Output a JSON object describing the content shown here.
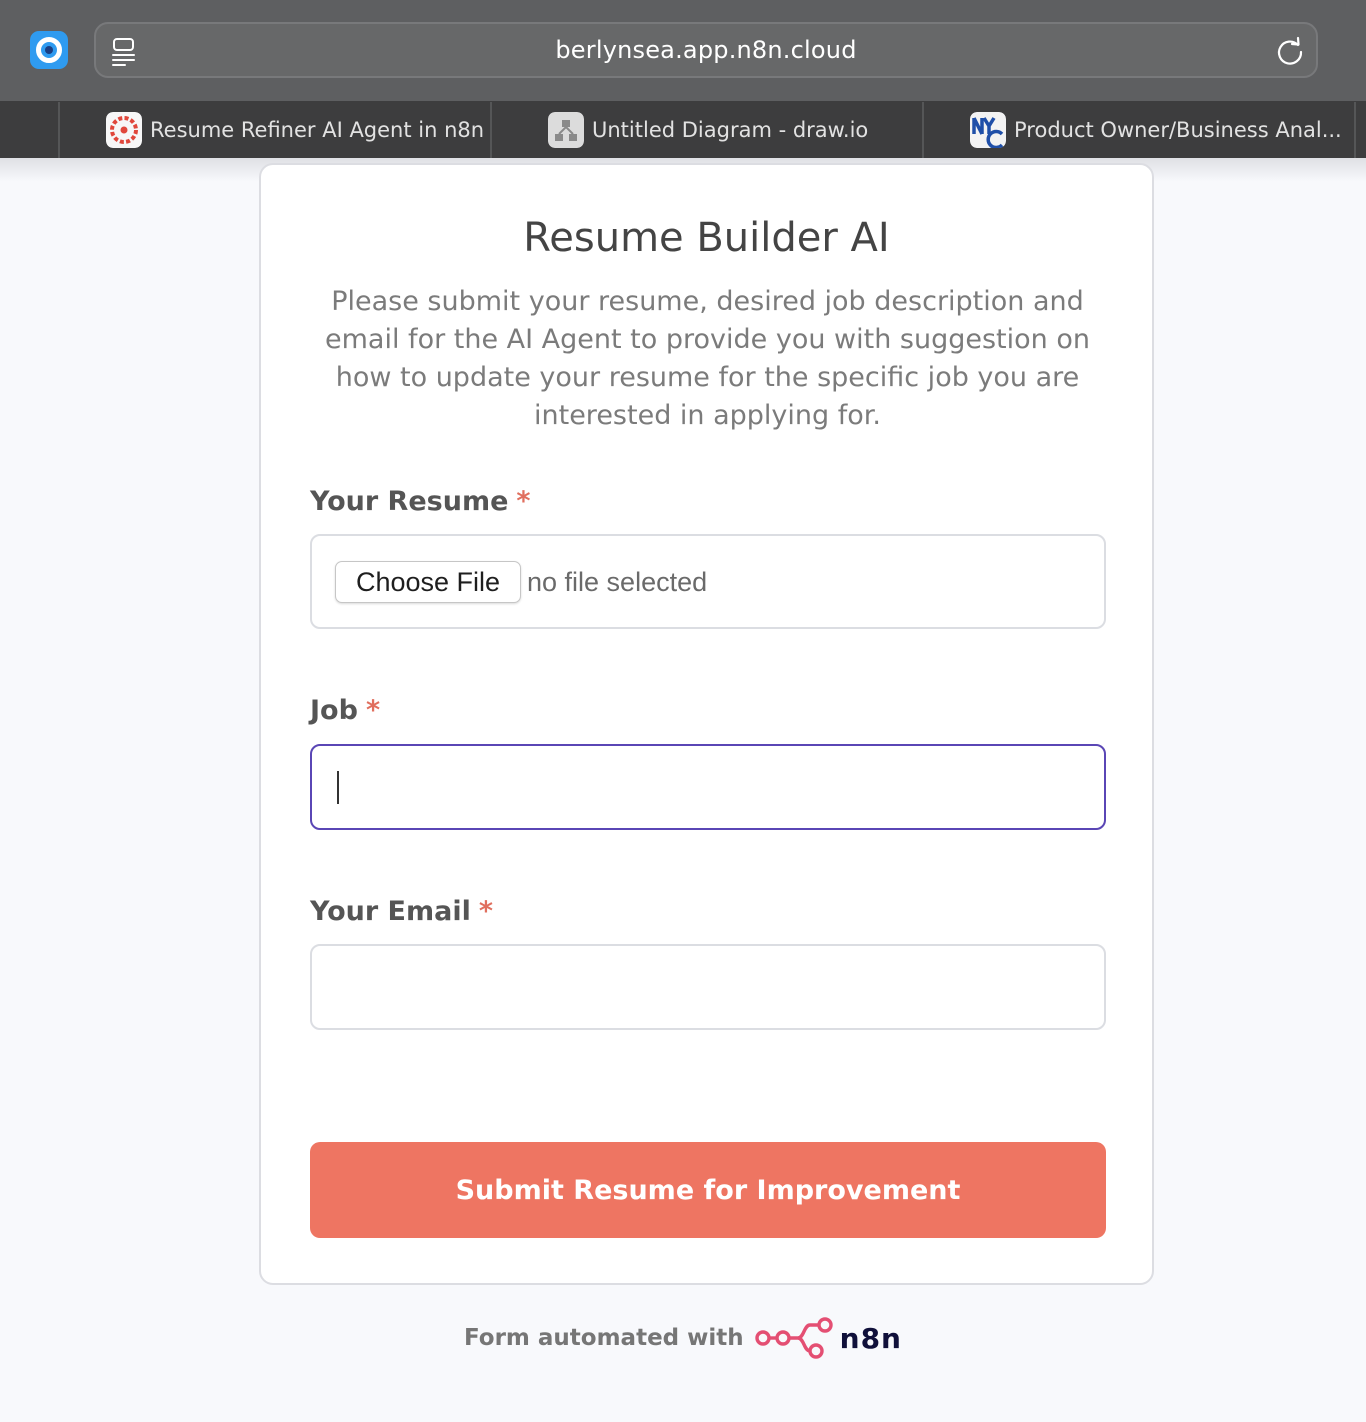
{
  "browser": {
    "url": "berlynsea.app.n8n.cloud",
    "tabs": [
      {
        "label": "Resume Refiner AI Agent in n8n",
        "icon": "n8n-favicon-icon"
      },
      {
        "label": "Untitled Diagram - draw.io",
        "icon": "drawio-favicon-icon"
      },
      {
        "label": "Product Owner/Business Anal...",
        "icon": "nyc-favicon-icon"
      }
    ]
  },
  "form": {
    "title": "Resume Builder AI",
    "description": "Please submit your resume, desired job description and email for the AI Agent to provide you with suggestion on how to update your resume for the specific job you are interested in applying for.",
    "required_marker": "*",
    "fields": {
      "resume": {
        "label": "Your Resume",
        "button_label": "Choose File",
        "status": "no file selected"
      },
      "job": {
        "label": "Job",
        "value": ""
      },
      "email": {
        "label": "Your Email",
        "value": ""
      }
    },
    "submit_label": "Submit Resume for Improvement"
  },
  "footer": {
    "text": "Form automated with",
    "brand": "n8n"
  },
  "colors": {
    "accent": "#ee7562",
    "focus_border": "#5a46b5",
    "required": "#e06f5e",
    "brand_dark": "#10103a"
  }
}
